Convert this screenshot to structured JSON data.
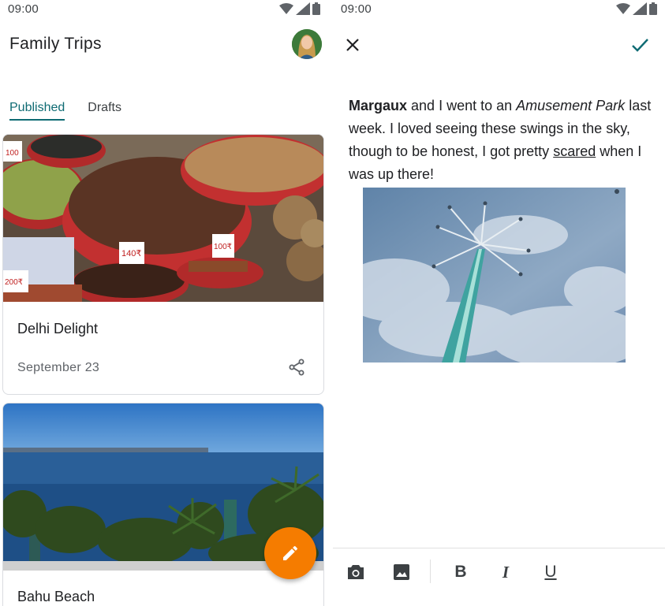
{
  "status": {
    "time": "09:00"
  },
  "list_screen": {
    "title": "Family Trips",
    "tabs": [
      {
        "label": "Published",
        "active": true
      },
      {
        "label": "Drafts",
        "active": false
      }
    ],
    "cards": [
      {
        "title": "Delhi Delight",
        "date": "September 23"
      },
      {
        "title": "Bahu Beach"
      }
    ],
    "price_tags": [
      "100",
      "140₹",
      "100₹",
      "200₹"
    ]
  },
  "editor_screen": {
    "text": {
      "bold": "Margaux",
      "part1": " and I went to an ",
      "italic": "Amusement Park",
      "part2": " last week. I loved seeing these swings in the sky, though to be honest, I got pretty ",
      "underline": "scared",
      "part3": " when I was up there!"
    },
    "toolbar": {
      "bold_glyph": "B",
      "italic_glyph": "I",
      "underline_glyph": "U"
    }
  },
  "colors": {
    "accent": "#0e6b73",
    "fab": "#f57c00",
    "text": "#202124",
    "secondary": "#5f6368"
  },
  "icons": [
    "wifi-icon",
    "signal-icon",
    "battery-icon",
    "close-icon",
    "check-icon",
    "share-icon",
    "edit-icon",
    "camera-icon",
    "image-icon"
  ]
}
